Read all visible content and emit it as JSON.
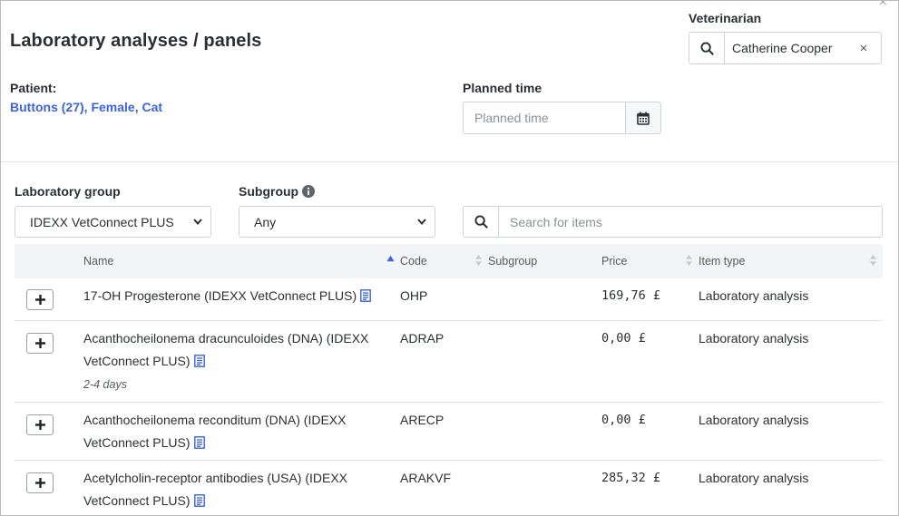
{
  "header": {
    "title": "Laboratory analyses / panels",
    "close_glyph": "×"
  },
  "veterinarian": {
    "label": "Veterinarian",
    "value": "Catherine Cooper",
    "clear_glyph": "×"
  },
  "patient": {
    "label": "Patient:",
    "value": "Buttons (27), Female, Cat"
  },
  "planned_time": {
    "label": "Planned time",
    "placeholder": "Planned time"
  },
  "filters": {
    "lab_group_label": "Laboratory group",
    "lab_group_value": "IDEXX VetConnect PLUS",
    "subgroup_label": "Subgroup",
    "subgroup_value": "Any",
    "search_placeholder": "Search for items"
  },
  "table": {
    "columns": [
      "Name",
      "Code",
      "Subgroup",
      "Price",
      "Item type"
    ],
    "rows": [
      {
        "name": "17-OH Progesterone (IDEXX VetConnect PLUS)",
        "code": "OHP",
        "subgroup": "",
        "price": "169,76 £",
        "item_type": "Laboratory analysis",
        "note": ""
      },
      {
        "name_line1": "Acanthocheilonema dracunculoides (DNA) (IDEXX",
        "name_line2": "VetConnect PLUS)",
        "code": "ADRAP",
        "subgroup": "",
        "price": "0,00 £",
        "item_type": "Laboratory analysis",
        "note": "2-4 days"
      },
      {
        "name_line1": "Acanthocheilonema reconditum (DNA) (IDEXX",
        "name_line2": "VetConnect PLUS)",
        "code": "ARECP",
        "subgroup": "",
        "price": "0,00 £",
        "item_type": "Laboratory analysis",
        "note": ""
      },
      {
        "name_line1": "Acetylcholin-receptor antibodies (USA) (IDEXX",
        "name_line2": "VetConnect PLUS)",
        "code": "ARAKVF",
        "subgroup": "",
        "price": "285,32 £",
        "item_type": "Laboratory analysis",
        "note": ""
      }
    ]
  },
  "colors": {
    "accent_blue": "#3a64d8",
    "text": "#2b2f33",
    "border": "#ced3d8"
  }
}
